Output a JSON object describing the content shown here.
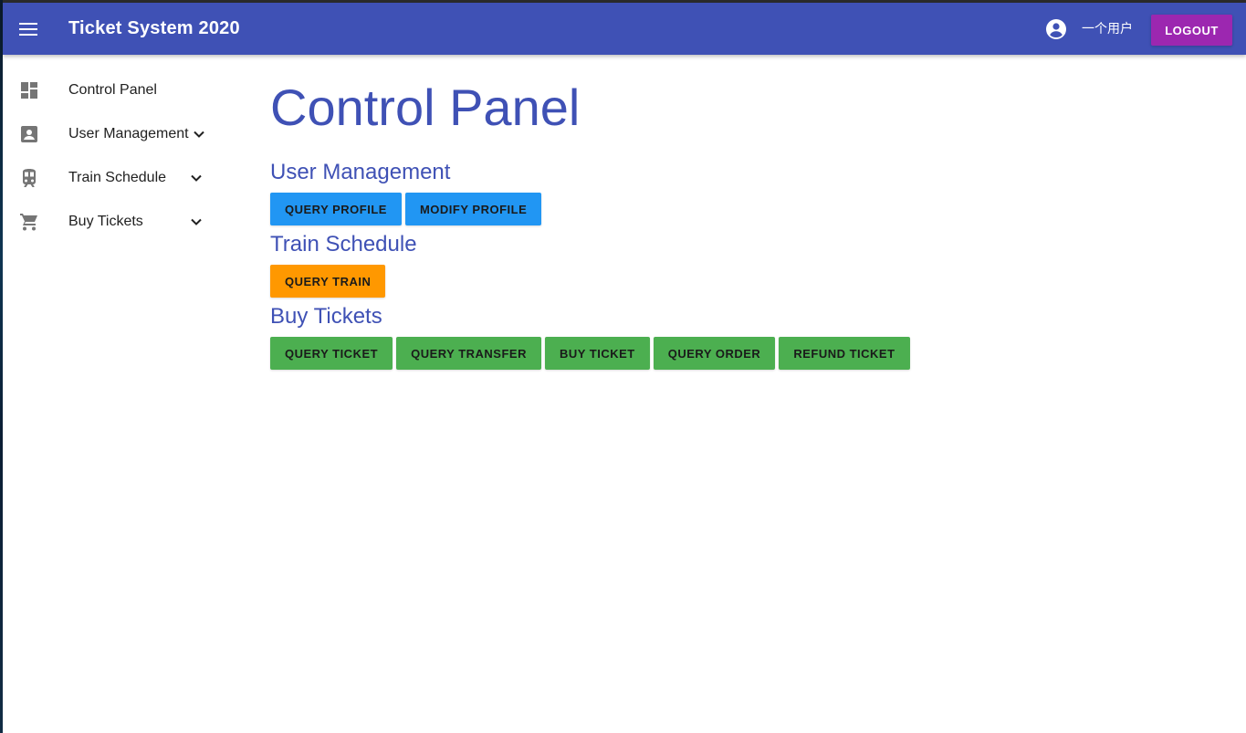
{
  "appbar": {
    "title": "Ticket System 2020",
    "username": "一个用户",
    "logout_label": "LOGOUT",
    "menu_icon": "menu-icon",
    "account_icon": "account-circle-icon"
  },
  "sidebar": {
    "items": [
      {
        "label": "Control Panel",
        "icon": "dashboard-icon",
        "expandable": false
      },
      {
        "label": "User Management",
        "icon": "account-box-icon",
        "expandable": true
      },
      {
        "label": "Train Schedule",
        "icon": "train-icon",
        "expandable": true
      },
      {
        "label": "Buy Tickets",
        "icon": "shopping-cart-icon",
        "expandable": true
      }
    ]
  },
  "main": {
    "title": "Control Panel",
    "sections": [
      {
        "title": "User Management",
        "buttons": [
          "QUERY PROFILE",
          "MODIFY PROFILE"
        ]
      },
      {
        "title": "Train Schedule",
        "buttons": [
          "QUERY TRAIN"
        ]
      },
      {
        "title": "Buy Tickets",
        "buttons": [
          "QUERY TICKET",
          "QUERY TRANSFER",
          "BUY TICKET",
          "QUERY ORDER",
          "REFUND TICKET"
        ]
      }
    ]
  },
  "colors": {
    "primary": "#3f51b5",
    "accent": "#9c27b0",
    "user_management_buttons": "#2196f3",
    "train_schedule_buttons": "#ff9800",
    "buy_tickets_buttons": "#4caf50"
  }
}
